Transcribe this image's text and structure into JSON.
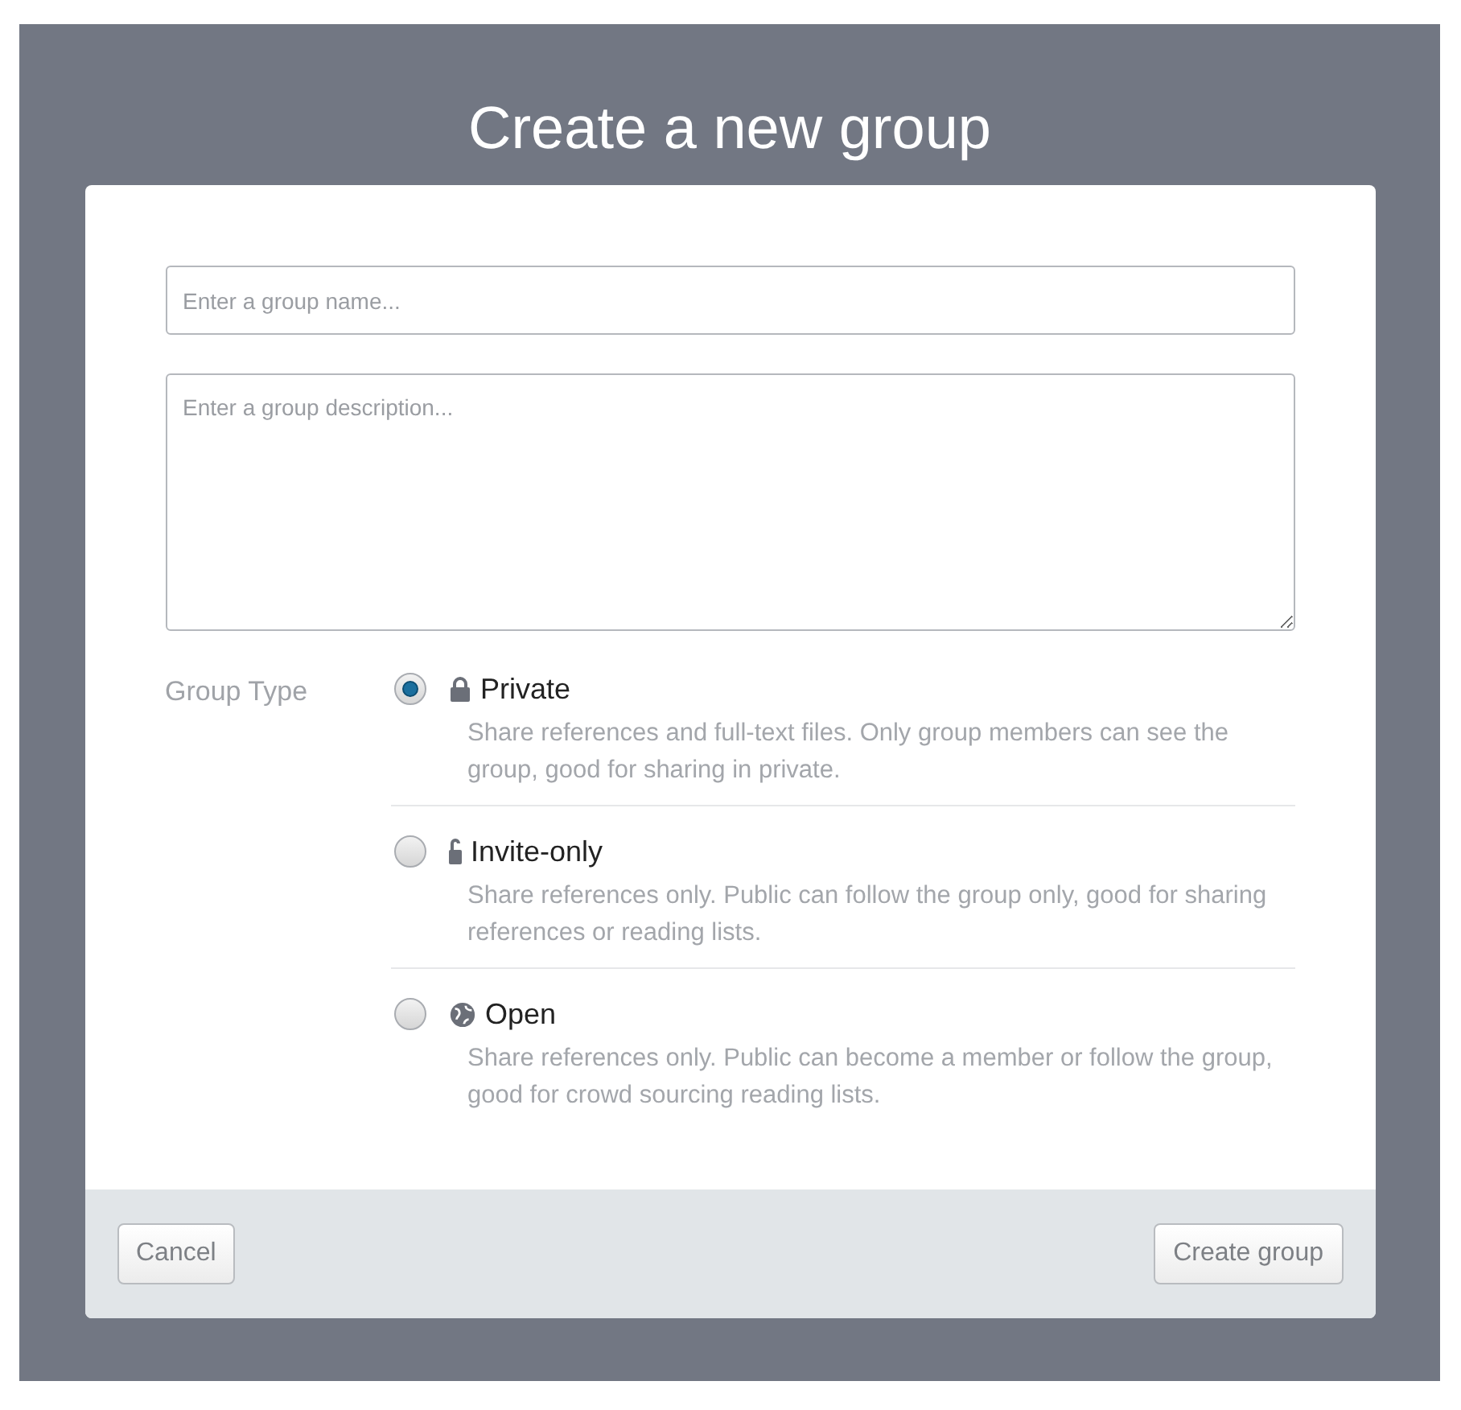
{
  "title": "Create a new group",
  "name_field": {
    "placeholder": "Enter a group name..."
  },
  "description_field": {
    "placeholder": "Enter a group description..."
  },
  "group_type": {
    "label": "Group Type",
    "options": [
      {
        "kind": "lock",
        "label": "Private",
        "description": "Share references and full-text files. Only group members can see the group, good for sharing in private.",
        "selected": true
      },
      {
        "kind": "half-lock",
        "label": "Invite-only",
        "description": "Share references only. Public can follow the group only, good for sharing references or reading lists.",
        "selected": false
      },
      {
        "kind": "globe",
        "label": "Open",
        "description": "Share references only. Public can become a member or follow the group, good for crowd sourcing reading lists.",
        "selected": false
      }
    ]
  },
  "buttons": {
    "cancel": "Cancel",
    "create": "Create group"
  }
}
